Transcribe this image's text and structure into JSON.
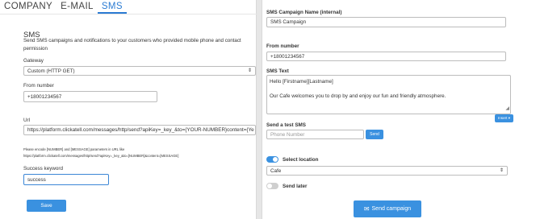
{
  "tabs": [
    "COMPANY",
    "E-MAIL",
    "SMS"
  ],
  "sms": {
    "title": "SMS",
    "description": "Send SMS campaigns and notifications to your customers who provided mobile phone and contact permission",
    "gateway_label": "Gateway",
    "gateway_value": "Custom (HTTP GET)",
    "from_label": "From number",
    "from_value": "+18001234567",
    "url_label": "Url",
    "url_value": "https://platform.clickatell.com/messages/http/send?apiKey=_key_&to={YOUR-NUMBER}content={Ye",
    "note_line1": "Please encode [NUMBER] and [MESSAGE] parameters in URL like",
    "note_line2": "https://platform.clickatell.com/messages/http/send?apiKey=_key_&to=[NUMBER]&content=[MESSAGE]",
    "keyword_label": "Success keyword",
    "keyword_value": "success",
    "save_label": "Save"
  },
  "campaign": {
    "name_label": "SMS Campaign Name (internal)",
    "name_value": "SMS Campaign",
    "from_label": "From number",
    "from_value": "+18001234567",
    "text_label": "SMS Text",
    "text_line1": "Hello [Firstname][Lastname]",
    "text_line2": "Our Cafe welcomes you to drop by and enjoy our fun and friendly atmosphere.",
    "insert_label": "Insert ▾",
    "test_label": "Send a test SMS",
    "phone_placeholder": "Phone Number",
    "send_label": "Send",
    "select_location_label": "Select location",
    "location_value": "Cafe",
    "send_later_label": "Send later",
    "send_campaign_label": "Send campaign"
  },
  "colors": {
    "accent": "#3a91e0",
    "active_tab": "#2b7bd3"
  }
}
